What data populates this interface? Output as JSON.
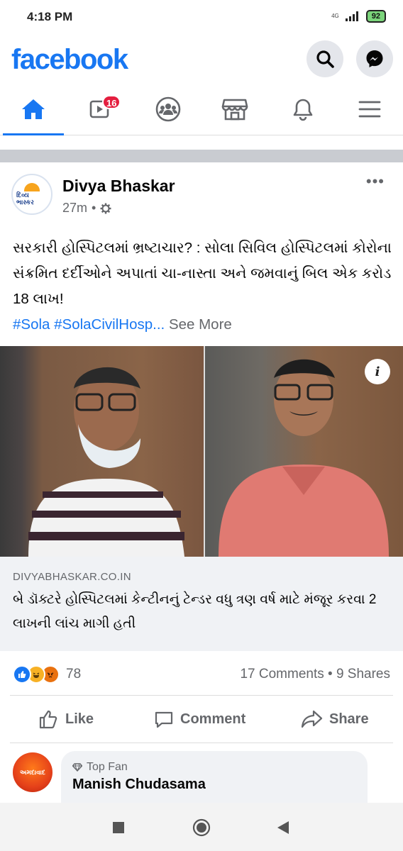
{
  "status_bar": {
    "time": "4:18 PM",
    "network": "4G",
    "battery": "92"
  },
  "header": {
    "logo": "facebook",
    "search_icon": "search-icon",
    "messenger_icon": "messenger-icon"
  },
  "nav": {
    "items": [
      {
        "name": "home",
        "icon": "home-icon",
        "active": true
      },
      {
        "name": "watch",
        "icon": "video-icon",
        "badge": "16"
      },
      {
        "name": "groups",
        "icon": "groups-icon"
      },
      {
        "name": "marketplace",
        "icon": "store-icon"
      },
      {
        "name": "notifications",
        "icon": "bell-icon"
      },
      {
        "name": "menu",
        "icon": "hamburger-icon"
      }
    ],
    "accent_color": "#1877f2"
  },
  "post": {
    "page_name": "Divya Bhaskar",
    "avatar_text": "દિવ્ય ભાસ્કર",
    "time": "27m",
    "text": "સરકારી હોસ્પિટલમાં ભ્રષ્ટાચાર? : સોલા સિવિલ હોસ્પિટલમાં કોરોના સંક્રમિત દર્દીઓને અપાતાં ચા-નાસ્તા અને જમવાનું બિલ એક કરોડ 18 લાખ!",
    "hashtags": "#Sola #SolaCivilHosp...",
    "see_more": "See More",
    "link": {
      "domain": "DIVYABHASKAR.CO.IN",
      "title": "બે ડૉક્ટરે હોસ્પિટલમાં કેન્ટીનનું ટેન્ડર વધુ ત્રણ વર્ષ માટે મંજૂર કરવા 2 લાખની લાંચ માગી હતી"
    },
    "reaction_count": "78",
    "comments_shares": "17 Comments • 9 Shares",
    "actions": {
      "like": "Like",
      "comment": "Comment",
      "share": "Share"
    }
  },
  "comment": {
    "top_fan_label": "Top Fan",
    "name": "Manish Chudasama",
    "avatar_text": "અમદાવાદ"
  }
}
